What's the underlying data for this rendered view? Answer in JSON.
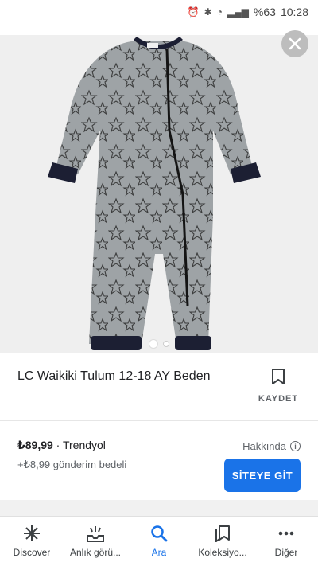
{
  "status": {
    "battery": "%63",
    "time": "10:28"
  },
  "product": {
    "title": "LC Waikiki Tulum 12-18 AY Beden",
    "save_label": "KAYDET",
    "price": "₺89,99",
    "seller": "· Trendyol",
    "shipping": "+₺8,99 gönderim bedeli",
    "about_label": "Hakkında",
    "visit_label": "SİTEYE GİT"
  },
  "nav": {
    "items": [
      {
        "label": "Discover",
        "icon": "asterisk-icon"
      },
      {
        "label": "Anlık görü...",
        "icon": "updates-icon"
      },
      {
        "label": "Ara",
        "icon": "search-icon"
      },
      {
        "label": "Koleksiyo...",
        "icon": "collections-icon"
      },
      {
        "label": "Diğer",
        "icon": "more-icon"
      }
    ],
    "active_index": 2
  },
  "colors": {
    "accent": "#1a73e8",
    "romper": "#9ea3a6",
    "cuff": "#1c1f33"
  }
}
